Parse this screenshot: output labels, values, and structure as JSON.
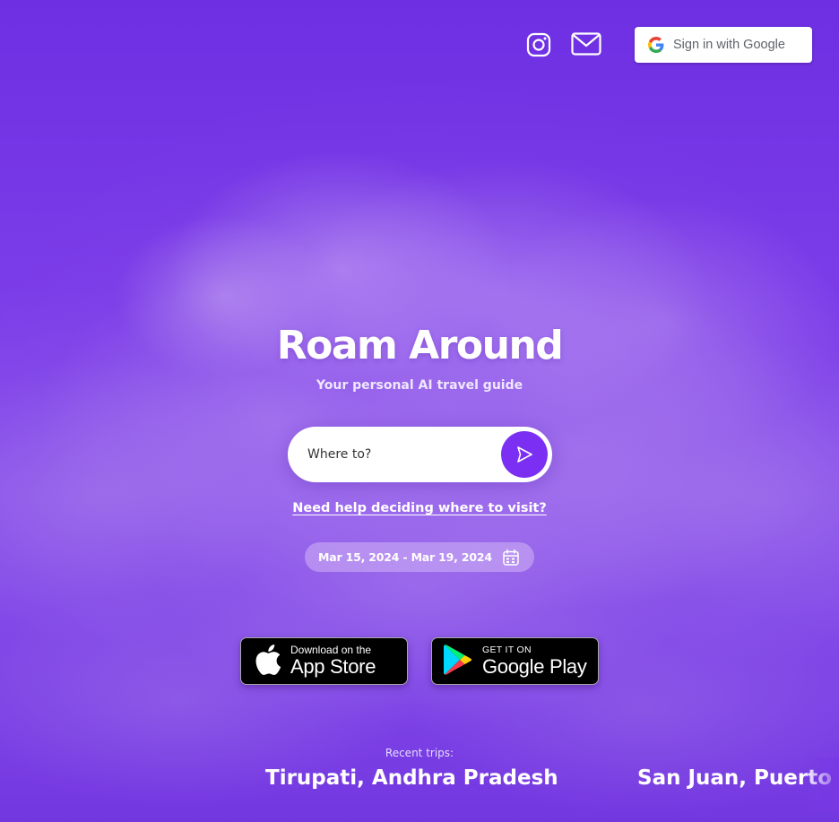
{
  "header": {
    "instagram_icon": "instagram-icon",
    "mail_icon": "mail-icon",
    "google_signin_label": "Sign in with Google"
  },
  "hero": {
    "title": "Roam Around",
    "subtitle": "Your personal AI travel guide"
  },
  "search": {
    "placeholder": "Where to?",
    "value": "",
    "submit_icon": "send-icon"
  },
  "help_link": "Need help deciding where to visit?",
  "date_range": {
    "label": "Mar 15, 2024 - Mar 19, 2024",
    "icon": "calendar-icon"
  },
  "store_badges": {
    "apple": {
      "small": "Download on the",
      "big": "App Store"
    },
    "google": {
      "small": "GET IT ON",
      "big": "Google Play"
    }
  },
  "recent": {
    "label": "Recent trips:",
    "trips": [
      "Tirupati, Andhra Pradesh",
      "San Juan, Puerto"
    ]
  },
  "colors": {
    "background": "#7a38e6",
    "accent": "#7b2ff2",
    "white": "#ffffff"
  }
}
